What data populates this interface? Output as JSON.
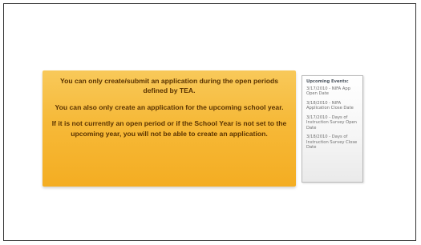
{
  "callout": {
    "paragraphs": [
      "You can only create/submit an application during the open periods defined by TEA.",
      "You can also only create an application for the upcoming school year.",
      "If it is not currently an open period or if the School Year is not set to the upcoming year, you will not be able to create an application."
    ]
  },
  "upcoming_events": {
    "title": "Upcoming Events:",
    "items": [
      "3/17/2010 - NIFA App Open Date",
      "3/18/2010 - NIFA Application Close Date",
      "3/17/2010 - Days of Instruction Survey Open Date",
      "3/18/2010 - Days of Instruction Survey Close Date"
    ]
  },
  "colors": {
    "callout_top": "#f8c95a",
    "callout_bottom": "#f4ad22",
    "callout_text": "#5a3300",
    "frame_border": "#333333"
  }
}
